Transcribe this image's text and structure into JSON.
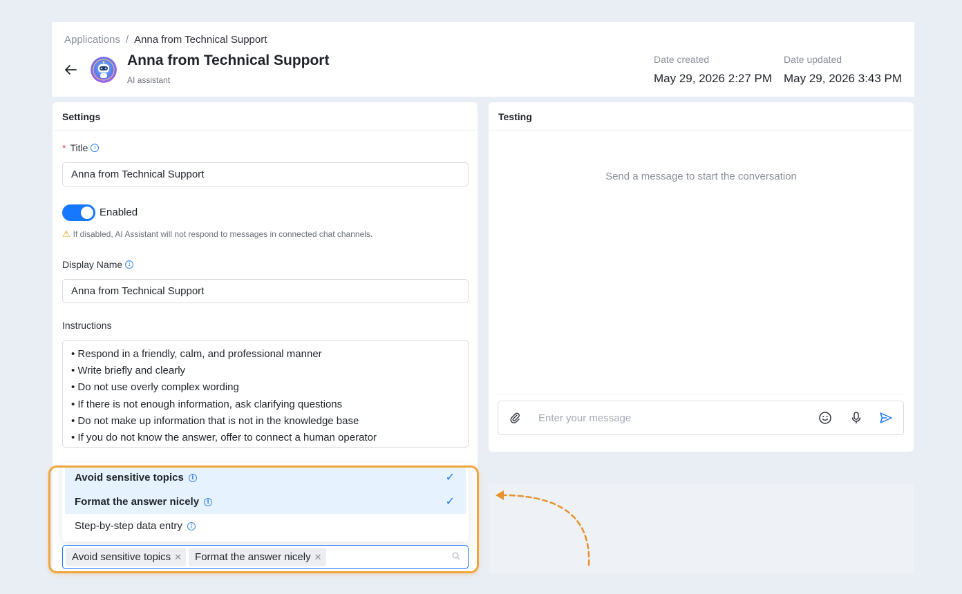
{
  "header": {
    "breadcrumb_root": "Applications",
    "breadcrumb_sep": "/",
    "breadcrumb_current": "Anna from Technical Support",
    "title": "Anna from Technical Support",
    "subtitle": "AI assistant",
    "date_created_label": "Date created",
    "date_created": "May 29, 2026 2:27 PM",
    "date_updated_label": "Date updated",
    "date_updated": "May 29, 2026 3:43 PM"
  },
  "settings": {
    "heading": "Settings",
    "title_label": "Title",
    "title_required": "*",
    "title_value": "Anna from Technical Support",
    "enabled_label": "Enabled",
    "enabled": true,
    "enabled_warning": "If disabled, AI Assistant will not respond to messages in connected chat channels.",
    "display_name_label": "Display Name",
    "display_name_value": "Anna from Technical Support",
    "instructions_label": "Instructions",
    "instructions": [
      "• Respond in a friendly, calm, and professional manner",
      "• Write briefly and clearly",
      "• Do not use overly complex wording",
      "• If there is not enough information, ask clarifying questions",
      "• Do not make up information that is not in the knowledge base",
      "• If you do not know the answer, offer to connect a human operator"
    ],
    "options": [
      {
        "label": "Avoid sensitive topics",
        "selected": true
      },
      {
        "label": "Format the answer nicely",
        "selected": true
      },
      {
        "label": "Step-by-step data entry",
        "selected": false
      }
    ],
    "selected_tags": [
      "Avoid sensitive topics",
      "Format the answer nicely"
    ]
  },
  "testing": {
    "heading": "Testing",
    "empty_message": "Send a message to start the conversation",
    "input_placeholder": "Enter your message"
  },
  "colors": {
    "accent": "#1677ff",
    "highlight": "#f0a53c",
    "background": "#e9eef5"
  }
}
